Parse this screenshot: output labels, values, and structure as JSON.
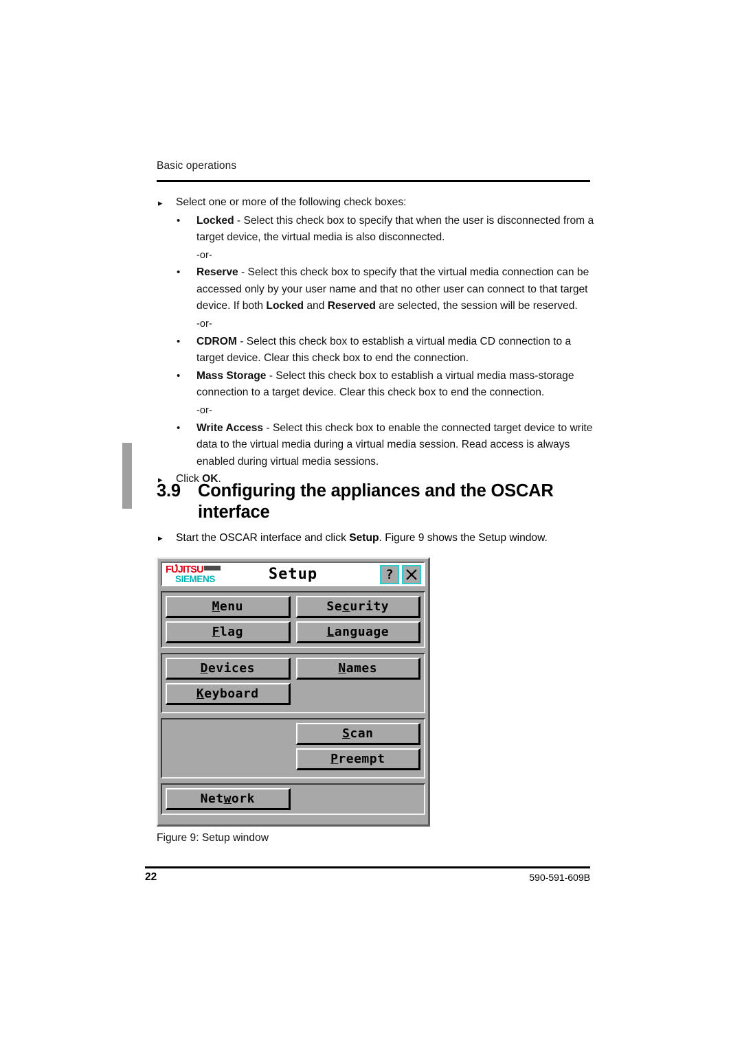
{
  "document": {
    "running_header": "Basic operations",
    "page_number": "22",
    "doc_number": "590-591-609B"
  },
  "body": {
    "step1": {
      "marker": "▸",
      "text": "Select one or more of the following check boxes:"
    },
    "bullets": [
      {
        "dot": "•",
        "term": "Locked",
        "text": " - Select this check box to specify that when the user is disconnected from a target device, the virtual media is also disconnected."
      },
      {
        "dot": "•",
        "term": "Reserve",
        "text_a": " - Select this check box to specify that the virtual media connection can be accessed only by your user name and that no other user can connect to that target device. If both ",
        "term_b": "Locked",
        "text_b": " and ",
        "term_c": "Reserved",
        "text_c": " are selected, the session will be reserved."
      },
      {
        "dot": "•",
        "term": "CDROM",
        "text": " - Select this check box to establish a virtual media CD connection to a target device. Clear this check box to end the connection."
      },
      {
        "dot": "•",
        "term": "Mass Storage",
        "text": " - Select this check box to establish a virtual media mass-storage connection to a target device. Clear this check box to end the connection."
      },
      {
        "dot": "•",
        "term": "Write Access",
        "text": " - Select this check box to enable the connected target device to write data to the virtual media during a virtual media session. Read access is always enabled during virtual media sessions."
      }
    ],
    "or_label": "-or-",
    "step_click_ok": {
      "marker": "▸",
      "text_a": "Click ",
      "term": "OK",
      "text_b": "."
    },
    "section": {
      "number": "3.9",
      "title": "Configuring the appliances and the OSCAR interface"
    },
    "intro_step": {
      "marker": "▸",
      "text_a": "Start the OSCAR interface and click ",
      "term": "Setup",
      "text_b": ". Figure 9 shows the Setup window."
    },
    "figure_caption": "Figure 9: Setup window"
  },
  "oscar_dialog": {
    "logo": {
      "line1": "FUJITSU",
      "line2": "SIEMENS",
      "color_line1": "#d70011",
      "color_line2": "#00b2b2"
    },
    "title": "Setup",
    "title_buttons": [
      {
        "name": "help-button",
        "label": "?"
      },
      {
        "name": "close-button",
        "label": "✕"
      }
    ],
    "groups": [
      {
        "name": "group-menu",
        "left": [
          "Menu",
          "Flag"
        ],
        "right": [
          "Security",
          "Language"
        ],
        "left_mnemonics": [
          0,
          0
        ],
        "right_mnemonics": [
          2,
          0
        ]
      },
      {
        "name": "group-devices",
        "left": [
          "Devices",
          "Keyboard"
        ],
        "right": [
          "Names"
        ],
        "left_mnemonics": [
          0,
          0
        ],
        "right_mnemonics": [
          0
        ]
      },
      {
        "name": "group-scan",
        "left": [],
        "right": [
          "Scan",
          "Preempt"
        ],
        "right_mnemonics": [
          0,
          0
        ]
      },
      {
        "name": "group-network",
        "left": [
          "Network"
        ],
        "right": [],
        "left_mnemonics": [
          3
        ]
      }
    ],
    "colors": {
      "face": "#a8a8a8",
      "accent_button_border": "#2ec9c9"
    }
  }
}
